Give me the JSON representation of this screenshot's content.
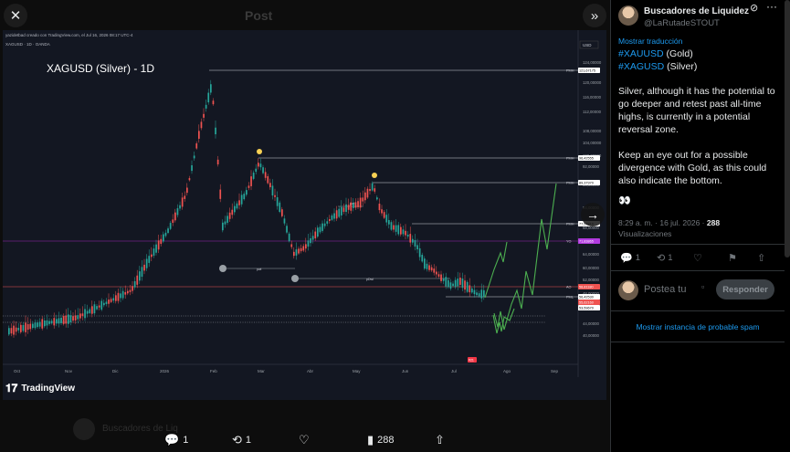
{
  "viewer": {
    "close_icon": "✕",
    "expand_icon": "»",
    "next_icon": "→",
    "post_label": "Post"
  },
  "chart": {
    "header_line": "yazidetbad creado con TradingView.com, el Jul 16, 2026 08:17 UTC-4",
    "subheader": "XAGUSD · 1D · OANDA",
    "title": "XAGUSD (Silver) - 1D",
    "currency": "USD",
    "price_ticks": [
      "124,00000",
      "120,00000",
      "116,00000",
      "112,00000",
      "108,00000",
      "104,00000",
      "100,00000",
      "92,00000",
      "88,00000",
      "84,00000",
      "68,00000",
      "64,00000",
      "60,00000",
      "52,00000",
      "48,00000",
      "44,00000",
      "40,00000"
    ],
    "month_ticks": [
      "Oct",
      "Nov",
      "Dic",
      "2026",
      "Feb",
      "Mar",
      "Abr",
      "May",
      "Jun",
      "Jul",
      "Ago",
      "Sep"
    ],
    "level_tags": [
      {
        "tag": "PMH",
        "price": "121,67175"
      },
      {
        "tag": "PMH",
        "price": "96,42555"
      },
      {
        "tag": "PMH",
        "price": "89,37970"
      },
      {
        "tag": "PMH",
        "price": "77,57810"
      },
      {
        "tag": "YO",
        "price": "71,83865"
      },
      {
        "tag": "AO",
        "price": "58,81180"
      },
      {
        "tag": "PML",
        "price": "56,42530"
      },
      {
        "tag": "",
        "price": "55,62160"
      },
      {
        "tag": "",
        "price": "53,59670"
      }
    ],
    "current_badge": "#21",
    "level_labels": [
      "pwl",
      "pwl",
      "pDwl"
    ],
    "brand": "TradingView",
    "chart_data": {
      "type": "candlestick",
      "title": "XAGUSD (Silver) - 1D",
      "xlabel": "",
      "ylabel": "USD",
      "x": [
        "Oct",
        "Nov",
        "Dic",
        "2026",
        "Feb",
        "Mar",
        "Abr",
        "May",
        "Jun",
        "Jul",
        "Ago",
        "Sep"
      ],
      "ylim": [
        40,
        126
      ],
      "close_approx": [
        46,
        48,
        56,
        72,
        100,
        92,
        78,
        84,
        72,
        58,
        0,
        0
      ],
      "key_levels": [
        121.67175,
        96.42555,
        89.3797,
        77.5781,
        71.83865,
        58.8118,
        56.4253,
        55.6216,
        53.5967
      ]
    }
  },
  "media_actions": {
    "replies": "1",
    "reposts": "1",
    "views": "288"
  },
  "bg_post": {
    "text": "Buscadores de Liq"
  },
  "tweet": {
    "author_name": "Buscadores de Liquidez",
    "author_handle": "@LaRutadeSTOUT",
    "translate": "Mostrar traducción",
    "tag1": "#XAUUSD",
    "tag1_rest": " (Gold)",
    "tag2": "#XAGUSD",
    "tag2_rest": " (Silver)",
    "para1": "Silver, although it has the potential to go deeper and retest past all-time highs, is currently in a potential reversal zone.",
    "para2": "Keep an eye out for a possible divergence with Gold, as this could also indicate the bottom.",
    "emoji": "👀",
    "time": "8:29 a. m. · 16 jul. 2026 · ",
    "views": "288",
    "views_label": "Visualizaciones",
    "replies": "1",
    "reposts": "1"
  },
  "reply": {
    "placeholder": "Postea tu",
    "button": "Responder"
  },
  "spam_link": "Mostrar instancia de probable spam"
}
